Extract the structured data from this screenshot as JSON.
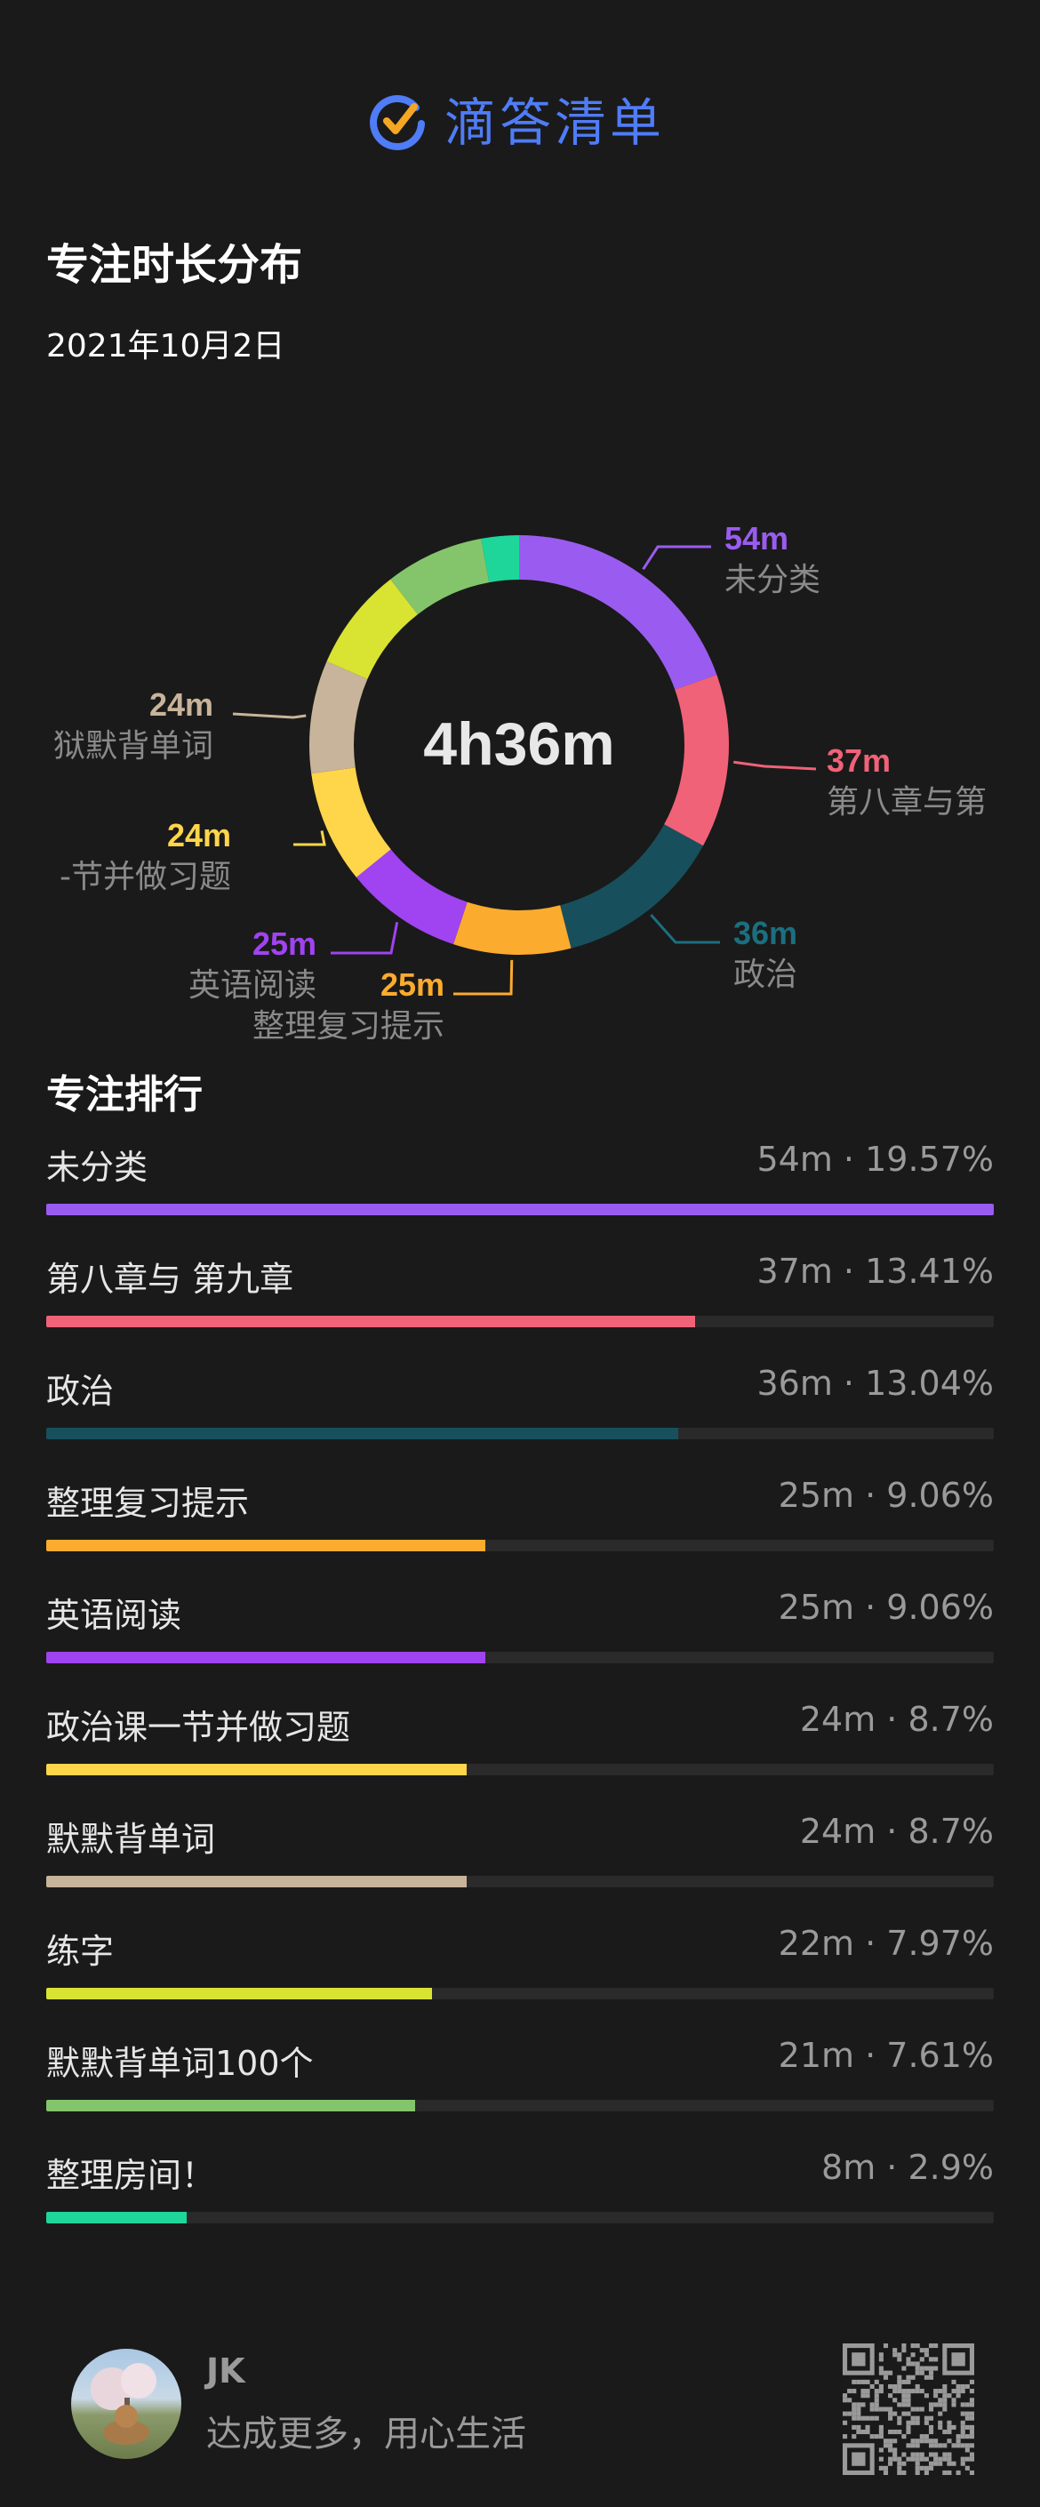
{
  "header": {
    "app_name": "滴答清单",
    "brand_color": "#4f7cf7",
    "check_color": "#f5a623",
    "logo_icon": "check-circle-icon"
  },
  "page": {
    "title": "专注时长分布",
    "date": "2021年10月2日"
  },
  "chart_data": {
    "type": "pie",
    "center_label": "4h36m",
    "slices": [
      {
        "label": "未分类",
        "value_label": "54m",
        "minutes": 54,
        "color": "#9a5cf0",
        "legend": true,
        "label_color": "#9a5cf0"
      },
      {
        "label": "第八章与第",
        "value_label": "37m",
        "minutes": 37,
        "color": "#f06278",
        "legend": true,
        "label_color": "#f06278"
      },
      {
        "label": "政治",
        "value_label": "36m",
        "minutes": 36,
        "color": "#17505c",
        "legend": true,
        "label_color": "#1a6f80"
      },
      {
        "label": "整理复习提示",
        "value_label": "25m",
        "minutes": 25,
        "color": "#fbab2e",
        "legend": true,
        "label_color": "#fbab2e"
      },
      {
        "label": "英语阅读",
        "value_label": "25m",
        "minutes": 25,
        "color": "#a043f0",
        "legend": true,
        "label_color": "#a043f0"
      },
      {
        "label": "-节并做习题",
        "value_label": "24m",
        "minutes": 24,
        "color": "#ffd54a",
        "legend": true,
        "label_color": "#ffd54a"
      },
      {
        "label": "狱默背单词",
        "value_label": "24m",
        "minutes": 24,
        "color": "#c8b49a",
        "legend": true,
        "label_color": "#c8b49a"
      },
      {
        "label": "",
        "value_label": "",
        "minutes": 22,
        "color": "#d9e332",
        "legend": false,
        "label_color": "#d9e332"
      },
      {
        "label": "",
        "value_label": "",
        "minutes": 21,
        "color": "#84c56c",
        "legend": false,
        "label_color": "#84c56c"
      },
      {
        "label": "",
        "value_label": "",
        "minutes": 8,
        "color": "#1ed69a",
        "legend": false,
        "label_color": "#1ed69a"
      }
    ]
  },
  "ranking": {
    "title": "专注排行",
    "items": [
      {
        "name": "未分类",
        "stat": "54m · 19.57%",
        "fraction": 1.0,
        "color": "#9a5cf0"
      },
      {
        "name": "第八章与 第九章",
        "stat": "37m · 13.41%",
        "fraction": 0.685,
        "color": "#f06278"
      },
      {
        "name": "政治",
        "stat": "36m · 13.04%",
        "fraction": 0.667,
        "color": "#17505c"
      },
      {
        "name": "整理复习提示",
        "stat": "25m · 9.06%",
        "fraction": 0.463,
        "color": "#fbab2e"
      },
      {
        "name": "英语阅读",
        "stat": "25m · 9.06%",
        "fraction": 0.463,
        "color": "#a043f0"
      },
      {
        "name": "政治课一节并做习题",
        "stat": "24m · 8.7%",
        "fraction": 0.444,
        "color": "#ffd54a"
      },
      {
        "name": "默默背单词",
        "stat": "24m · 8.7%",
        "fraction": 0.444,
        "color": "#c8b49a"
      },
      {
        "name": "练字",
        "stat": "22m · 7.97%",
        "fraction": 0.407,
        "color": "#d9e332"
      },
      {
        "name": "默默背单词100个",
        "stat": "21m · 7.61%",
        "fraction": 0.389,
        "color": "#84c56c"
      },
      {
        "name": "整理房间！",
        "stat": "8m · 2.9%",
        "fraction": 0.148,
        "color": "#1ed69a"
      }
    ]
  },
  "footer": {
    "user_name": "JK",
    "slogan": "达成更多，用心生活",
    "avatar_icon": "user-avatar",
    "qr_icon": "qr-code-icon"
  }
}
